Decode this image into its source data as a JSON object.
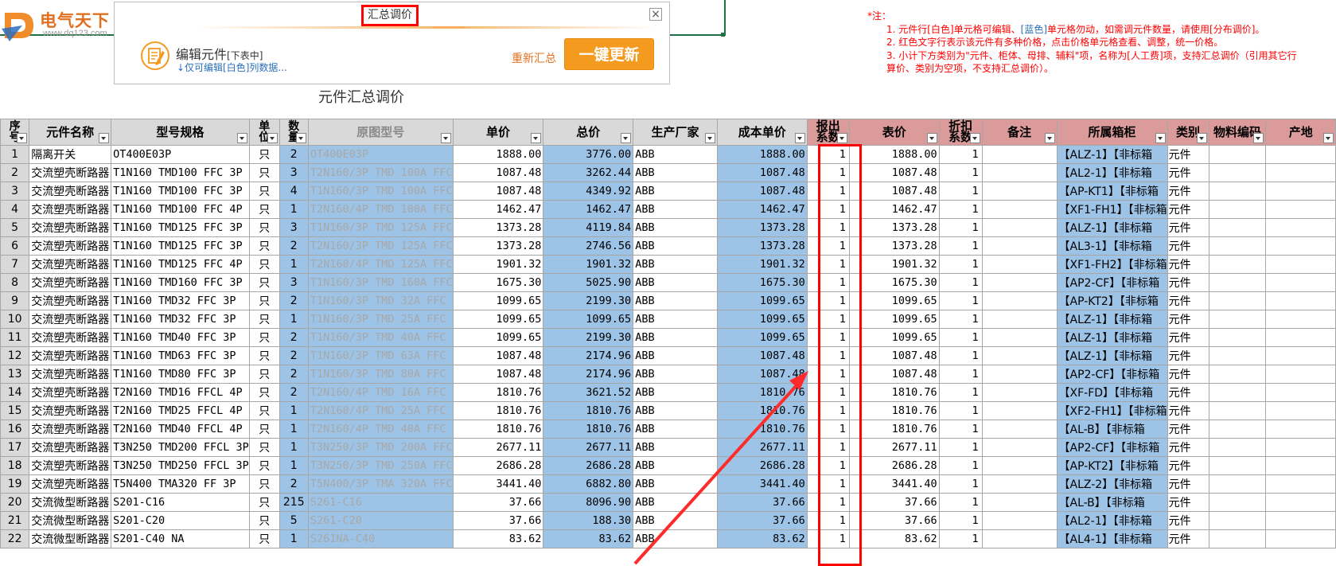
{
  "logo": {
    "name": "电气天下",
    "url": "www.dq123.com"
  },
  "dialog": {
    "title": "汇总调价",
    "close_icon": "close-icon",
    "edit_label": "编辑元件",
    "edit_sub": "[下表中]",
    "edit_hint": "↓仅可编辑[白色]列数据...",
    "recalc": "重新汇总",
    "update_button": "一键更新",
    "accent_color": "#f39a1f"
  },
  "notes": {
    "header": "*注：",
    "line1_a": "1. 元件行[白色]单元格可编辑、",
    "line1_blue": "[蓝色]",
    "line1_b": "单元格勿动，如需调元件数量，请使用[分布调价]。",
    "line2": "2. 红色文字行表示该元件有多种价格，点击价格单元格查看、调整，统一价格。",
    "line3a": "3. 小计下方类别为\"元件、柜体、母排、辅料\"项，名称为[人工费]项，支持汇总调价（引用其它行",
    "line3b": "算价、类别为空项，不支持汇总调价）。"
  },
  "sheet_title": "元件汇总调价",
  "columns": [
    "序号",
    "元件名称",
    "型号规格",
    "单位",
    "数量",
    "原图型号",
    "单价",
    "总价",
    "生产厂家",
    "成本单价",
    "报出系数",
    "表价",
    "折扣系数",
    "备注",
    "所属箱柜",
    "类别",
    "物料编码",
    "产地"
  ],
  "rows": [
    {
      "i": "1",
      "name": "隔离开关",
      "spec": "OT400E03P",
      "unit": "只",
      "qty": "2",
      "model": "OT400E03P",
      "price": "1888.00",
      "total": "3776.00",
      "mfr": "ABB",
      "cost": "1888.00",
      "coef": "1",
      "list": "1888.00",
      "disc": "1",
      "cab": "【ALZ-1】【非标箱",
      "cat": "元件"
    },
    {
      "i": "2",
      "name": "交流塑壳断路器",
      "spec": "T1N160 TMD100 FFC 3P",
      "unit": "只",
      "qty": "3",
      "model": "T2N160/3P TMD 100A FFC",
      "price": "1087.48",
      "total": "3262.44",
      "mfr": "ABB",
      "cost": "1087.48",
      "coef": "1",
      "list": "1087.48",
      "disc": "1",
      "cab": "【AL2-1】【非标箱",
      "cat": "元件"
    },
    {
      "i": "3",
      "name": "交流塑壳断路器",
      "spec": "T1N160 TMD100 FFC 3P",
      "unit": "只",
      "qty": "4",
      "model": "T1N160/3P TMD 100A FFC",
      "price": "1087.48",
      "total": "4349.92",
      "mfr": "ABB",
      "cost": "1087.48",
      "coef": "1",
      "list": "1087.48",
      "disc": "1",
      "cab": "【AP-KT1】【非标箱",
      "cat": "元件"
    },
    {
      "i": "4",
      "name": "交流塑壳断路器",
      "spec": "T1N160 TMD100 FFC 4P",
      "unit": "只",
      "qty": "1",
      "model": "T2N160/4P TMD 100A FFC",
      "price": "1462.47",
      "total": "1462.47",
      "mfr": "ABB",
      "cost": "1462.47",
      "coef": "1",
      "list": "1462.47",
      "disc": "1",
      "cab": "【XF1-FH1】【非标箱",
      "cat": "元件"
    },
    {
      "i": "5",
      "name": "交流塑壳断路器",
      "spec": "T1N160 TMD125 FFC 3P",
      "unit": "只",
      "qty": "3",
      "model": "T1N160/3P TMD 125A FFC",
      "price": "1373.28",
      "total": "4119.84",
      "mfr": "ABB",
      "cost": "1373.28",
      "coef": "1",
      "list": "1373.28",
      "disc": "1",
      "cab": "【ALZ-1】【非标箱",
      "cat": "元件"
    },
    {
      "i": "6",
      "name": "交流塑壳断路器",
      "spec": "T1N160 TMD125 FFC 3P",
      "unit": "只",
      "qty": "2",
      "model": "T2N160/3P TMD 125A FFC",
      "price": "1373.28",
      "total": "2746.56",
      "mfr": "ABB",
      "cost": "1373.28",
      "coef": "1",
      "list": "1373.28",
      "disc": "1",
      "cab": "【AL3-1】【非标箱",
      "cat": "元件"
    },
    {
      "i": "7",
      "name": "交流塑壳断路器",
      "spec": "T1N160 TMD125 FFC 4P",
      "unit": "只",
      "qty": "1",
      "model": "T2N160/4P TMD 125A FFC",
      "price": "1901.32",
      "total": "1901.32",
      "mfr": "ABB",
      "cost": "1901.32",
      "coef": "1",
      "list": "1901.32",
      "disc": "1",
      "cab": "【XF1-FH2】【非标箱",
      "cat": "元件"
    },
    {
      "i": "8",
      "name": "交流塑壳断路器",
      "spec": "T1N160 TMD160 FFC 3P",
      "unit": "只",
      "qty": "3",
      "model": "T1N160/3P TMD 160A FFC",
      "price": "1675.30",
      "total": "5025.90",
      "mfr": "ABB",
      "cost": "1675.30",
      "coef": "1",
      "list": "1675.30",
      "disc": "1",
      "cab": "【AP2-CF】【非标箱",
      "cat": "元件"
    },
    {
      "i": "9",
      "name": "交流塑壳断路器",
      "spec": "T1N160 TMD32 FFC 3P",
      "unit": "只",
      "qty": "2",
      "model": "T1N160/3P TMD 32A FFC",
      "price": "1099.65",
      "total": "2199.30",
      "mfr": "ABB",
      "cost": "1099.65",
      "coef": "1",
      "list": "1099.65",
      "disc": "1",
      "cab": "【AP-KT2】【非标箱",
      "cat": "元件"
    },
    {
      "i": "10",
      "name": "交流塑壳断路器",
      "spec": "T1N160 TMD32 FFC 3P",
      "unit": "只",
      "qty": "1",
      "model": "T1N160/3P TMD 25A FFC",
      "price": "1099.65",
      "total": "1099.65",
      "mfr": "ABB",
      "cost": "1099.65",
      "coef": "1",
      "list": "1099.65",
      "disc": "1",
      "cab": "【ALZ-1】【非标箱",
      "cat": "元件"
    },
    {
      "i": "11",
      "name": "交流塑壳断路器",
      "spec": "T1N160 TMD40 FFC 3P",
      "unit": "只",
      "qty": "2",
      "model": "T1N160/3P TMD 40A FFC",
      "price": "1099.65",
      "total": "2199.30",
      "mfr": "ABB",
      "cost": "1099.65",
      "coef": "1",
      "list": "1099.65",
      "disc": "1",
      "cab": "【ALZ-1】【非标箱",
      "cat": "元件"
    },
    {
      "i": "12",
      "name": "交流塑壳断路器",
      "spec": "T1N160 TMD63 FFC 3P",
      "unit": "只",
      "qty": "2",
      "model": "T1N160/3P TMD 63A FFC",
      "price": "1087.48",
      "total": "2174.96",
      "mfr": "ABB",
      "cost": "1087.48",
      "coef": "1",
      "list": "1087.48",
      "disc": "1",
      "cab": "【ALZ-1】【非标箱",
      "cat": "元件"
    },
    {
      "i": "13",
      "name": "交流塑壳断路器",
      "spec": "T1N160 TMD80 FFC 3P",
      "unit": "只",
      "qty": "2",
      "model": "T1N160/3P TMD 80A FFC",
      "price": "1087.48",
      "total": "2174.96",
      "mfr": "ABB",
      "cost": "1087.48",
      "coef": "1",
      "list": "1087.48",
      "disc": "1",
      "cab": "【AP2-CF】【非标箱",
      "cat": "元件"
    },
    {
      "i": "14",
      "name": "交流塑壳断路器",
      "spec": "T2N160 TMD16 FFCL 4P",
      "unit": "只",
      "qty": "2",
      "model": "T2N160/4P TMD 16A FFC",
      "price": "1810.76",
      "total": "3621.52",
      "mfr": "ABB",
      "cost": "1810.76",
      "coef": "1",
      "list": "1810.76",
      "disc": "1",
      "cab": "【XF-FD】【非标箱",
      "cat": "元件"
    },
    {
      "i": "15",
      "name": "交流塑壳断路器",
      "spec": "T2N160 TMD25 FFCL 4P",
      "unit": "只",
      "qty": "1",
      "model": "T2N160/4P TMD 25A FFC",
      "price": "1810.76",
      "total": "1810.76",
      "mfr": "ABB",
      "cost": "1810.76",
      "coef": "1",
      "list": "1810.76",
      "disc": "1",
      "cab": "【XF2-FH1】【非标箱",
      "cat": "元件"
    },
    {
      "i": "16",
      "name": "交流塑壳断路器",
      "spec": "T2N160 TMD40 FFCL 4P",
      "unit": "只",
      "qty": "1",
      "model": "T2N160/4P TMD 40A FFC",
      "price": "1810.76",
      "total": "1810.76",
      "mfr": "ABB",
      "cost": "1810.76",
      "coef": "1",
      "list": "1810.76",
      "disc": "1",
      "cab": "【AL-B】【非标箱",
      "cat": "元件"
    },
    {
      "i": "17",
      "name": "交流塑壳断路器",
      "spec": "T3N250 TMD200 FFCL 3P",
      "unit": "只",
      "qty": "1",
      "model": "T3N250/3P TMD 200A FFC",
      "price": "2677.11",
      "total": "2677.11",
      "mfr": "ABB",
      "cost": "2677.11",
      "coef": "1",
      "list": "2677.11",
      "disc": "1",
      "cab": "【AP2-CF】【非标箱",
      "cat": "元件"
    },
    {
      "i": "18",
      "name": "交流塑壳断路器",
      "spec": "T3N250 TMD250 FFCL 3P",
      "unit": "只",
      "qty": "1",
      "model": "T3N250/3P TMD 250A FFC",
      "price": "2686.28",
      "total": "2686.28",
      "mfr": "ABB",
      "cost": "2686.28",
      "coef": "1",
      "list": "2686.28",
      "disc": "1",
      "cab": "【AP-KT2】【非标箱",
      "cat": "元件"
    },
    {
      "i": "19",
      "name": "交流塑壳断路器",
      "spec": "T5N400 TMA320 FF 3P",
      "unit": "只",
      "qty": "2",
      "model": "T5N400/3P TMA 320A FFC",
      "price": "3441.40",
      "total": "6882.80",
      "mfr": "ABB",
      "cost": "3441.40",
      "coef": "1",
      "list": "3441.40",
      "disc": "1",
      "cab": "【ALZ-2】【非标箱",
      "cat": "元件"
    },
    {
      "i": "20",
      "name": "交流微型断路器",
      "spec": "S201-C16",
      "unit": "只",
      "qty": "215",
      "model": "S261-C16",
      "price": "37.66",
      "total": "8096.90",
      "mfr": "ABB",
      "cost": "37.66",
      "coef": "1",
      "list": "37.66",
      "disc": "1",
      "cab": "【AL-B】【非标箱",
      "cat": "元件"
    },
    {
      "i": "21",
      "name": "交流微型断路器",
      "spec": "S201-C20",
      "unit": "只",
      "qty": "5",
      "model": "S261-C20",
      "price": "37.66",
      "total": "188.30",
      "mfr": "ABB",
      "cost": "37.66",
      "coef": "1",
      "list": "37.66",
      "disc": "1",
      "cab": "【AL2-1】【非标箱",
      "cat": "元件"
    },
    {
      "i": "22",
      "name": "交流微型断路器",
      "spec": "S201-C40 NA",
      "unit": "只",
      "qty": "1",
      "model": "S261NA-C40",
      "price": "83.62",
      "total": "83.62",
      "mfr": "ABB",
      "cost": "83.62",
      "coef": "1",
      "list": "83.62",
      "disc": "1",
      "cab": "【AL4-1】【非标箱",
      "cat": "元件"
    }
  ],
  "colors": {
    "header_gray": "#d9d9d9",
    "header_pink": "#db9b9b",
    "locked_blue": "#9dc3e6",
    "highlight_red": "#ff0000"
  }
}
